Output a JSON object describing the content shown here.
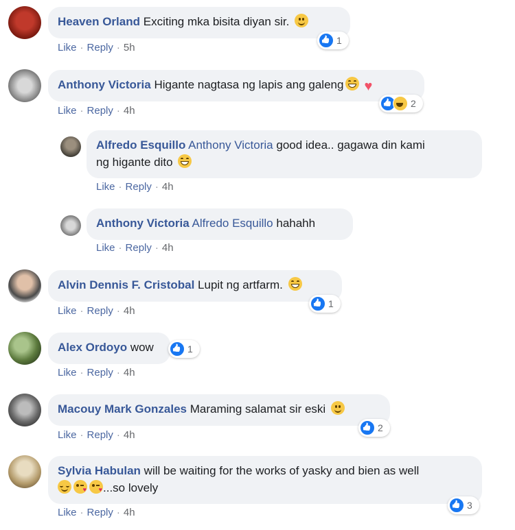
{
  "comments": [
    {
      "author": "Heaven Orland",
      "text": "Exciting mka bisita diyan sir.",
      "like": "Like",
      "reply": "Reply",
      "time": "5h",
      "reactions": "1"
    },
    {
      "author": "Anthony Victoria",
      "text": "Higante nagtasa ng lapis ang galeng",
      "like": "Like",
      "reply": "Reply",
      "time": "4h",
      "reactions": "2"
    },
    {
      "author": "Alfredo Esquillo",
      "mention": "Anthony Victoria",
      "text": "good idea.. gagawa din kami",
      "text2": "ng higante dito",
      "like": "Like",
      "reply": "Reply",
      "time": "4h"
    },
    {
      "author": "Anthony Victoria",
      "mention": "Alfredo Esquillo",
      "text": "hahahh",
      "like": "Like",
      "reply": "Reply",
      "time": "4h"
    },
    {
      "author": "Alvin Dennis F. Cristobal",
      "text": "Lupit ng artfarm.",
      "like": "Like",
      "reply": "Reply",
      "time": "4h",
      "reactions": "1"
    },
    {
      "author": "Alex Ordoyo",
      "text": "wow",
      "like": "Like",
      "reply": "Reply",
      "time": "4h",
      "reactions": "1"
    },
    {
      "author": "Macouy Mark Gonzales",
      "text": "Maraming salamat sir eski",
      "like": "Like",
      "reply": "Reply",
      "time": "4h",
      "reactions": "2"
    },
    {
      "author": "Sylvia Habulan",
      "text": "will be waiting for the works of yasky and bien as well",
      "text2": "...so lovely",
      "like": "Like",
      "reply": "Reply",
      "time": "4h",
      "reactions": "3"
    }
  ],
  "separator": "·",
  "colors": {
    "author": "#385898",
    "bubble": "#f0f2f5",
    "like_blue": "#1877f2"
  }
}
